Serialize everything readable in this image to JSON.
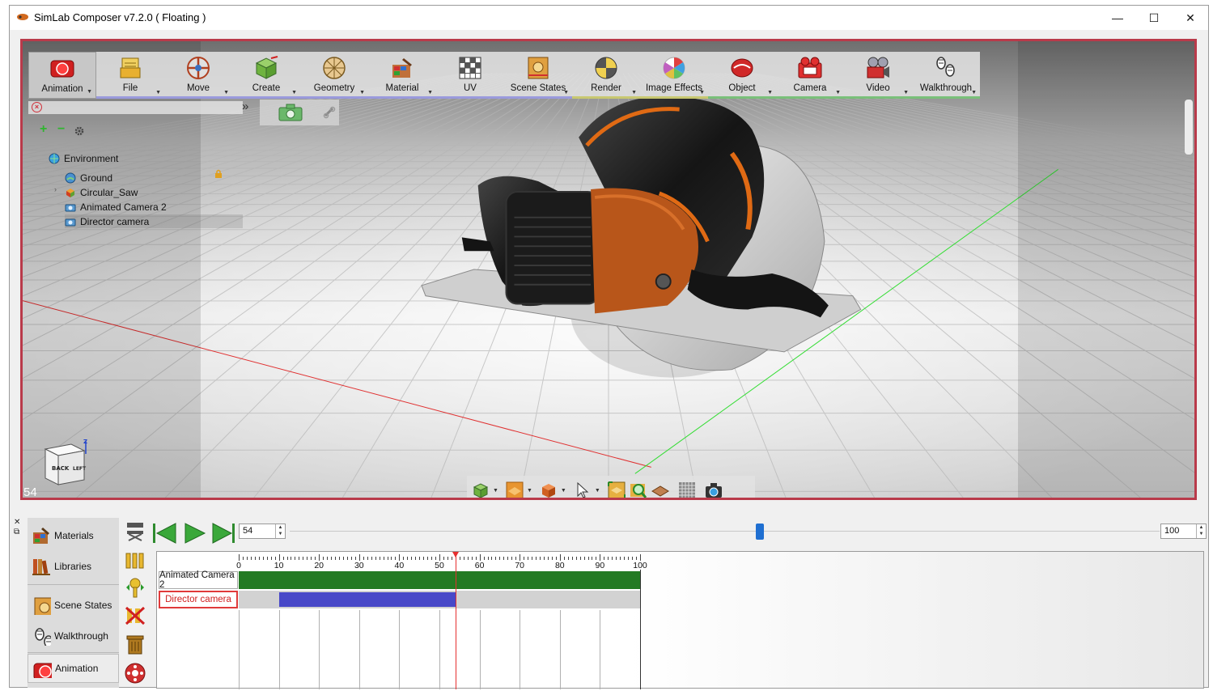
{
  "window": {
    "title": "SimLab Composer v7.2.0 ( Floating )",
    "controls": {
      "minimize": "—",
      "maximize": "☐",
      "close": "✕"
    }
  },
  "toolbar": {
    "tools": [
      {
        "label": "Animation",
        "icon": "animation-icon",
        "active": true,
        "strip": ""
      },
      {
        "label": "File",
        "icon": "file-icon",
        "strip": "#9a9adc"
      },
      {
        "label": "Move",
        "icon": "move-icon",
        "strip": "#9a9adc"
      },
      {
        "label": "Create",
        "icon": "create-icon",
        "strip": "#9a9adc"
      },
      {
        "label": "Geometry",
        "icon": "geometry-icon",
        "strip": "#9a9adc"
      },
      {
        "label": "Material",
        "icon": "material-icon",
        "strip": "#9a9adc"
      },
      {
        "label": "UV",
        "icon": "uv-icon",
        "strip": "#9a9adc"
      },
      {
        "label": "Scene States",
        "icon": "scene-states-icon",
        "strip": "#9a9adc"
      },
      {
        "label": "Render",
        "icon": "render-icon",
        "strip": "#c8c870"
      },
      {
        "label": "Image Effects",
        "icon": "image-effects-icon",
        "strip": "#c8c870"
      },
      {
        "label": "Object",
        "icon": "object-icon",
        "strip": "#7ac07a"
      },
      {
        "label": "Camera",
        "icon": "camera-icon",
        "strip": "#7ac07a"
      },
      {
        "label": "Video",
        "icon": "video-icon",
        "strip": "#7ac07a"
      },
      {
        "label": "Walkthrough",
        "icon": "walkthrough-icon",
        "strip": "#7ac07a"
      }
    ]
  },
  "scene_tree": {
    "items": [
      {
        "label": "Environment",
        "icon": "environment-icon"
      },
      {
        "label": "Ground",
        "icon": "ground-icon"
      },
      {
        "label": "Circular_Saw",
        "icon": "object-node-icon"
      },
      {
        "label": "Animated Camera 2",
        "icon": "camera-node-icon"
      },
      {
        "label": "Director camera",
        "icon": "camera-node-icon"
      }
    ]
  },
  "viewport": {
    "frame_number": "54",
    "cube_face_back": "BACK",
    "cube_face_left": "LEFT",
    "axis_z": "Z"
  },
  "side_tabs": [
    {
      "label": "Materials",
      "icon": "materials-icon"
    },
    {
      "label": "Libraries",
      "icon": "libraries-icon"
    },
    {
      "label": "Scene States",
      "icon": "scene-states-icon"
    },
    {
      "label": "Walkthrough",
      "icon": "walkthrough-icon"
    },
    {
      "label": "Animation",
      "icon": "animation-icon"
    }
  ],
  "transport": {
    "current_frame": "54",
    "end_frame": "100",
    "slider_position": 0.54
  },
  "timeline": {
    "start": 0,
    "end": 100,
    "tick_labels": [
      "0",
      "10",
      "20",
      "30",
      "40",
      "50",
      "60",
      "70",
      "80",
      "90",
      "100"
    ],
    "tracks": [
      {
        "name": "Animated Camera 2",
        "bar_start": 0,
        "bar_end": 100,
        "color": "#237a23"
      },
      {
        "name": "Director camera",
        "bar_start": 10,
        "bar_end": 54,
        "color": "#4848c8"
      }
    ],
    "playhead": 54
  }
}
